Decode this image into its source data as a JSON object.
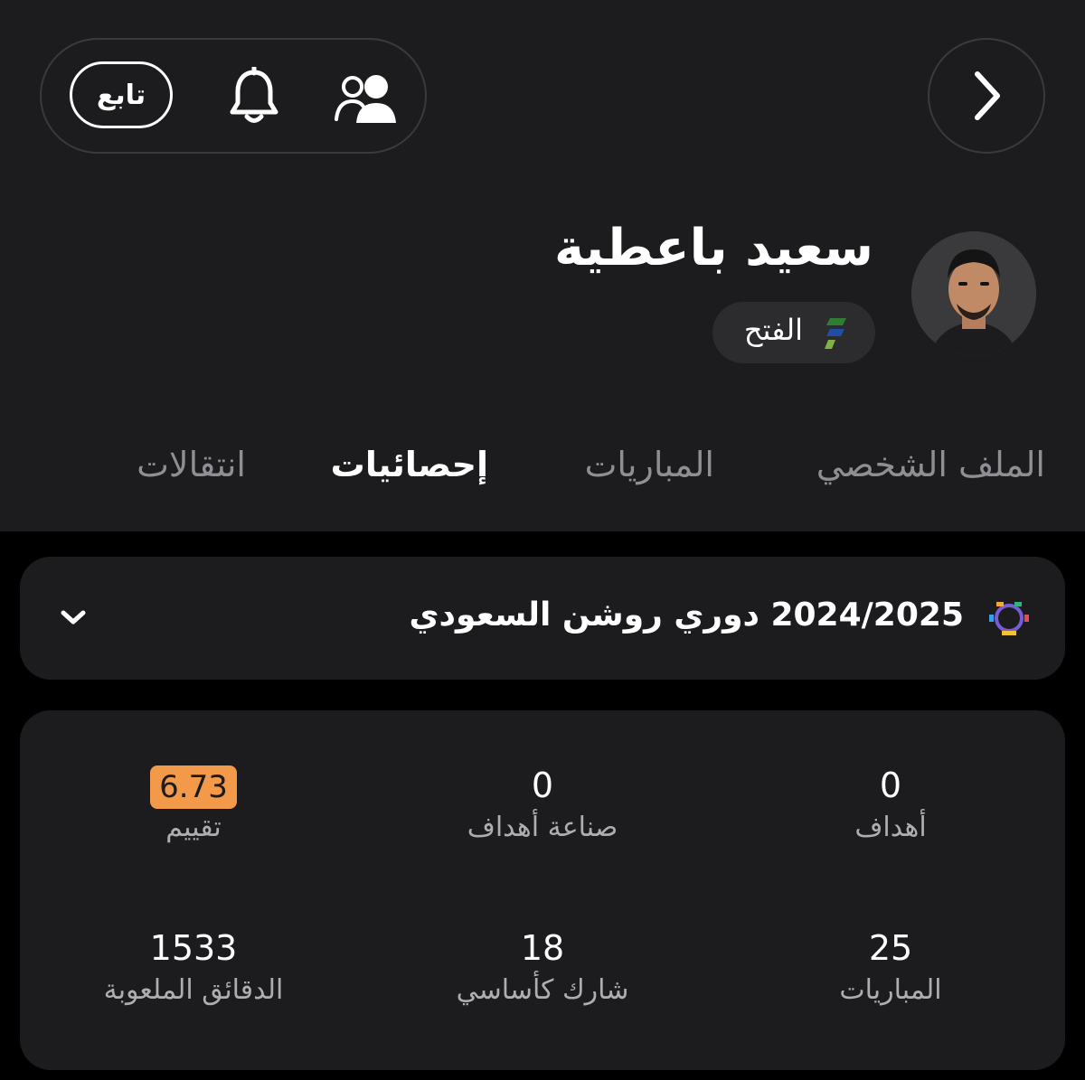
{
  "header": {
    "follow_label": "تابع",
    "player_name": "سعيد باعطية",
    "team_name": "الفتح"
  },
  "tabs": [
    {
      "label": "الملف الشخصي",
      "active": false
    },
    {
      "label": "المباريات",
      "active": false
    },
    {
      "label": "إحصائيات",
      "active": true
    },
    {
      "label": "انتقالات",
      "active": false
    }
  ],
  "league": {
    "title": "2024/2025 دوري روشن السعودي"
  },
  "stats": [
    {
      "value": "0",
      "label": "أهداف"
    },
    {
      "value": "0",
      "label": "صناعة أهداف"
    },
    {
      "value": "6.73",
      "label": "تقييم",
      "badge_color": "#f2994a"
    },
    {
      "value": "25",
      "label": "المباريات"
    },
    {
      "value": "18",
      "label": "شارك كأساسي"
    },
    {
      "value": "1533",
      "label": "الدقائق الملعوبة"
    }
  ],
  "icons": [
    "chevron-right-icon",
    "bell-icon",
    "people-icon",
    "chevron-down-icon",
    "team-logo-icon",
    "league-logo-icon"
  ]
}
